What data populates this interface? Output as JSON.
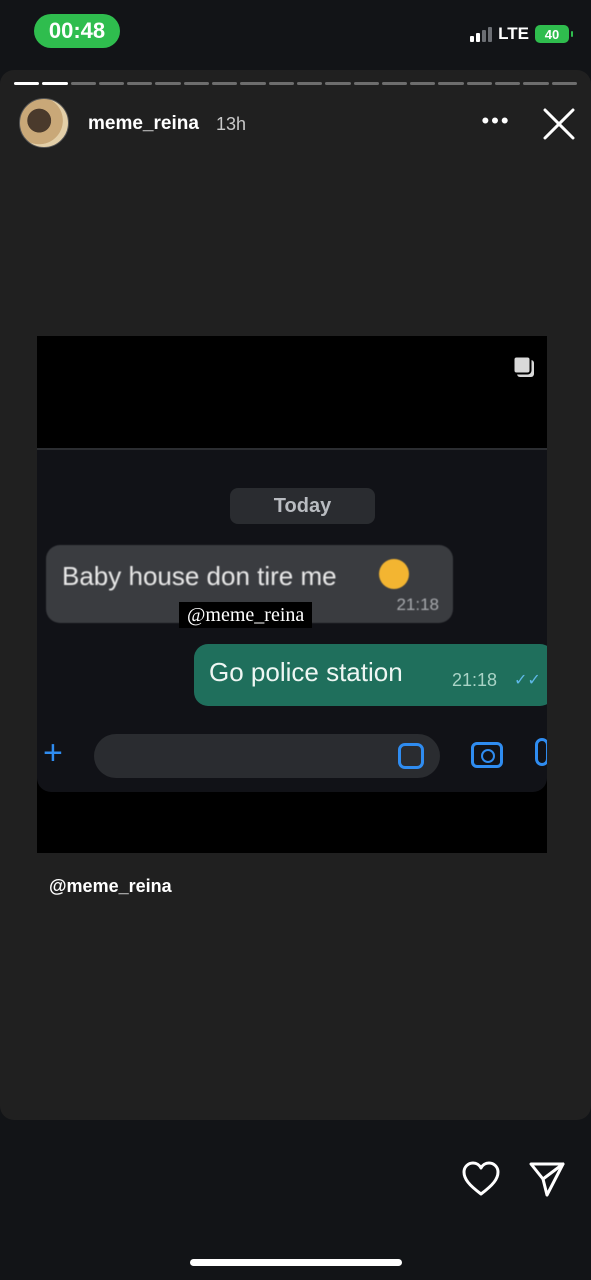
{
  "status_bar": {
    "time": "00:48",
    "network": "LTE",
    "battery": "40"
  },
  "story": {
    "progress_segments": 20,
    "progress_done": 2,
    "username": "meme_reina",
    "time_ago": "13h",
    "caption": "@meme_reina",
    "media": {
      "chat_date": "Today",
      "incoming_message": "Baby house don tire me",
      "incoming_time": "21:18",
      "watermark": "@meme_reina",
      "outgoing_message": "Go police station",
      "outgoing_time": "21:18"
    }
  },
  "icons": {
    "more": "more-options-icon",
    "close": "close-icon",
    "like": "heart-icon",
    "share": "send-icon"
  }
}
